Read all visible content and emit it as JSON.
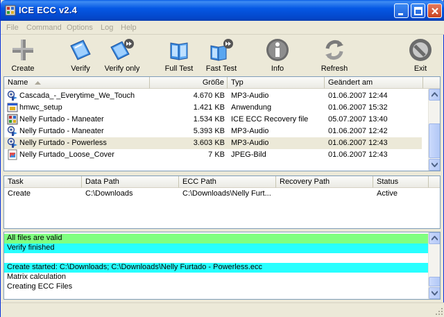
{
  "window": {
    "title": "ICE ECC v2.4"
  },
  "menu": [
    "File",
    "Command",
    "Options",
    "Log",
    "Help"
  ],
  "toolbar": [
    {
      "label": "Create",
      "icon": "plus-icon"
    },
    {
      "label": "Verify",
      "icon": "verify-icon"
    },
    {
      "label": "Verify only",
      "icon": "verify-only-icon"
    },
    {
      "label": "Full Test",
      "icon": "full-test-icon"
    },
    {
      "label": "Fast Test",
      "icon": "fast-test-icon"
    },
    {
      "label": "Info",
      "icon": "info-icon"
    },
    {
      "label": "Refresh",
      "icon": "refresh-icon"
    },
    {
      "label": "Exit",
      "icon": "exit-icon"
    }
  ],
  "files": {
    "columns": [
      "Name",
      "Größe",
      "Typ",
      "Geändert am"
    ],
    "rows": [
      {
        "name": "Cascada_-_Everytime_We_Touch",
        "size": "4.670 KB",
        "type": "MP3-Audio",
        "modified": "01.06.2007 12:44",
        "icon": "audio-file-icon"
      },
      {
        "name": "hmwc_setup",
        "size": "1.421 KB",
        "type": "Anwendung",
        "modified": "01.06.2007 15:32",
        "icon": "application-file-icon"
      },
      {
        "name": "Nelly Furtado - Maneater",
        "size": "1.534 KB",
        "type": "ICE ECC Recovery file",
        "modified": "05.07.2007 13:40",
        "icon": "ecc-file-icon"
      },
      {
        "name": "Nelly Furtado - Maneater",
        "size": "5.393 KB",
        "type": "MP3-Audio",
        "modified": "01.06.2007 12:42",
        "icon": "audio-file-icon"
      },
      {
        "name": "Nelly Furtado - Powerless",
        "size": "3.603 KB",
        "type": "MP3-Audio",
        "modified": "01.06.2007 12:43",
        "icon": "audio-file-icon"
      },
      {
        "name": "Nelly Furtado_Loose_Cover",
        "size": "7 KB",
        "type": "JPEG-Bild",
        "modified": "01.06.2007 12:43",
        "icon": "image-file-icon"
      }
    ]
  },
  "tasks": {
    "columns": [
      "Task",
      "Data Path",
      "ECC Path",
      "Recovery Path",
      "Status"
    ],
    "rows": [
      {
        "task": "Create",
        "data_path": "C:\\Downloads",
        "ecc_path": "C:\\Downloads\\Nelly Furt...",
        "recovery_path": "",
        "status": "Active"
      }
    ]
  },
  "log": [
    {
      "text": "All files are valid",
      "color": "#80ff80"
    },
    {
      "text": "Verify finished",
      "color": "#28ffff"
    },
    {
      "text": "",
      "color": ""
    },
    {
      "text": "Create started: C:\\Downloads; C:\\Downloads\\Nelly Furtado - Powerless.ecc",
      "color": "#28ffff"
    },
    {
      "text": "Matrix calculation",
      "color": ""
    },
    {
      "text": "Creating ECC Files",
      "color": ""
    }
  ]
}
